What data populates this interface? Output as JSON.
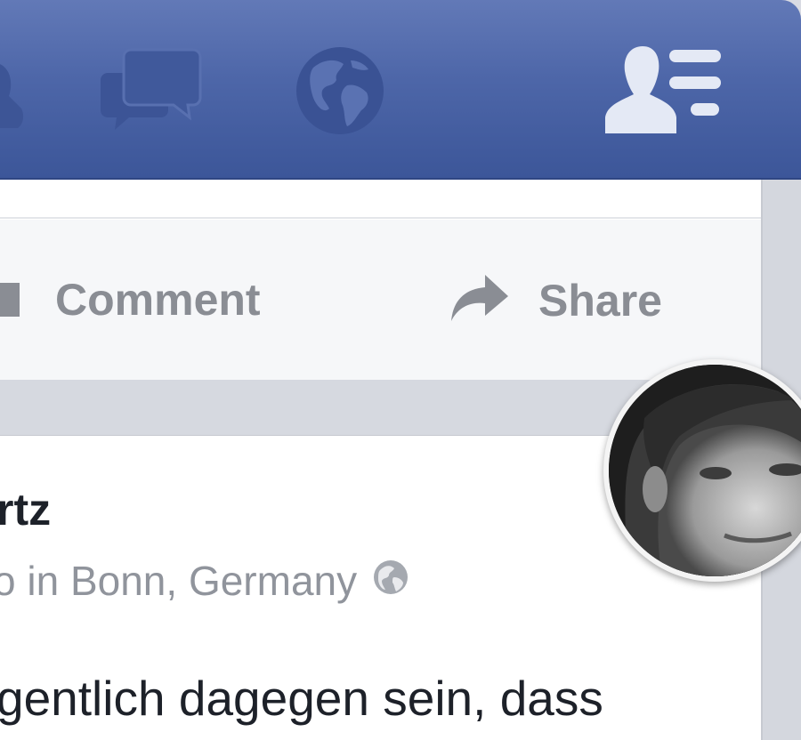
{
  "navbar": {
    "icons": [
      "friend-requests-icon",
      "messages-icon",
      "notifications-globe-icon",
      "friends-list-icon"
    ]
  },
  "post_actions": {
    "comment_label": "Comment",
    "share_label": "Share"
  },
  "post": {
    "author_name": "rtz",
    "location": "o in Bonn, Germany",
    "body": "gentlich dagegen sein, dass"
  },
  "colors": {
    "nav_blue": "#4d66a8",
    "action_gray": "#8a8d94",
    "text_dark": "#1d2129",
    "meta_gray": "#90949c"
  }
}
